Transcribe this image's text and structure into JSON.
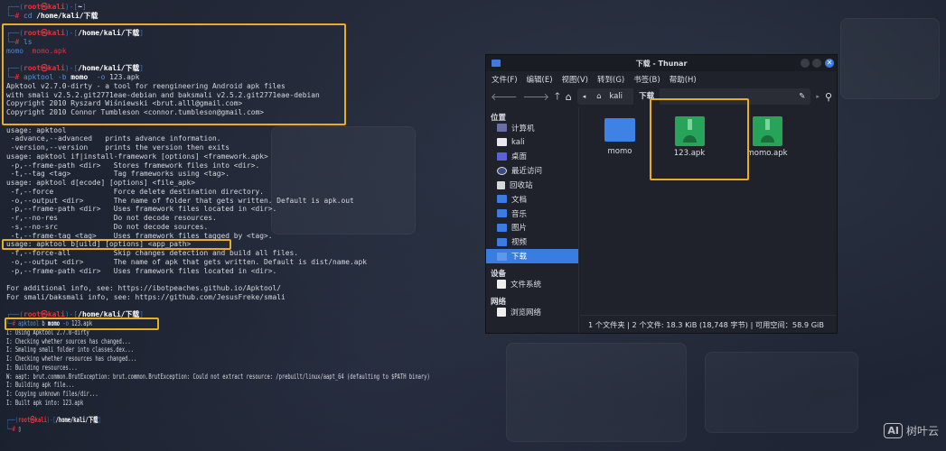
{
  "colors": {
    "frame": "#3c6fb5",
    "host": "#e3343e",
    "path": "#ffffff",
    "hash": "#e3343e",
    "text": "#d6d8de",
    "cmd": "#5b93d6",
    "dir": "#4a86e8",
    "apk": "#e3343e",
    "highlight": "#e8ad22",
    "accent": "#3a7de0"
  },
  "terminal": {
    "lines": [
      [
        [
          "┌──(",
          "frame"
        ],
        [
          "root㉿kali",
          "host"
        ],
        [
          ")-[",
          "frame"
        ],
        [
          "~",
          "path"
        ],
        [
          "]",
          "frame"
        ]
      ],
      [
        [
          "└─",
          "frame"
        ],
        [
          "# ",
          "hash"
        ],
        [
          "cd ",
          "cmd"
        ],
        [
          "/home/kali/下载",
          "path"
        ]
      ],
      [],
      [
        [
          "┌──(",
          "frame"
        ],
        [
          "root㉿kali",
          "host"
        ],
        [
          ")-[",
          "frame"
        ],
        [
          "/home/kali/下载",
          "path"
        ],
        [
          "]",
          "frame"
        ]
      ],
      [
        [
          "└─",
          "frame"
        ],
        [
          "# ",
          "hash"
        ],
        [
          "ls",
          "cmd"
        ]
      ],
      [
        [
          "momo",
          "dir"
        ],
        [
          "  ",
          "text"
        ],
        [
          "momo.apk",
          "apk"
        ]
      ],
      [],
      [
        [
          "┌──(",
          "frame"
        ],
        [
          "root㉿kali",
          "host"
        ],
        [
          ")-[",
          "frame"
        ],
        [
          "/home/kali/下载",
          "path"
        ],
        [
          "]",
          "frame"
        ]
      ],
      [
        [
          "└─",
          "frame"
        ],
        [
          "# ",
          "hash"
        ],
        [
          "apktool -b ",
          "cmd"
        ],
        [
          "momo",
          "path"
        ],
        [
          "  -o ",
          "cmd"
        ],
        [
          "123.apk",
          "text"
        ]
      ],
      [
        [
          "Apktool v2.7.0-dirty - a tool for reengineering Android apk files",
          "text"
        ]
      ],
      [
        [
          "with smali v2.5.2.git2771eae-debian and baksmali v2.5.2.git2771eae-debian",
          "text"
        ]
      ],
      [
        [
          "Copyright 2010 Ryszard Wiśniewski <brut.alll@gmail.com>",
          "text"
        ]
      ],
      [
        [
          "Copyright 2010 Connor Tumbleson <connor.tumbleson@gmail.com>",
          "text"
        ]
      ],
      [],
      [
        [
          "usage: apktool",
          "text"
        ]
      ],
      [
        [
          " -advance,--advanced   prints advance information.",
          "text"
        ]
      ],
      [
        [
          " -version,--version    prints the version then exits",
          "text"
        ]
      ],
      [
        [
          "usage: apktool if|install-framework [options] <framework.apk>",
          "text"
        ]
      ],
      [
        [
          " -p,--frame-path <dir>   Stores framework files into <dir>.",
          "text"
        ]
      ],
      [
        [
          " -t,--tag <tag>          Tag frameworks using <tag>.",
          "text"
        ]
      ],
      [
        [
          "usage: apktool d[ecode] [options] <file_apk>",
          "text"
        ]
      ],
      [
        [
          " -f,--force              Force delete destination directory.",
          "text"
        ]
      ],
      [
        [
          " -o,--output <dir>       The name of folder that gets written. Default is apk.out",
          "text"
        ]
      ],
      [
        [
          " -p,--frame-path <dir>   Uses framework files located in <dir>.",
          "text"
        ]
      ],
      [
        [
          " -r,--no-res             Do not decode resources.",
          "text"
        ]
      ],
      [
        [
          " -s,--no-src             Do not decode sources.",
          "text"
        ]
      ],
      [
        [
          " -t,--frame-tag <tag>    Uses framework files tagged by <tag>.",
          "text"
        ]
      ],
      [
        [
          "usage: apktool b[uild] [options] <app_path>",
          "text"
        ]
      ],
      [
        [
          " -f,--force-all          Skip changes detection and build all files.",
          "text"
        ]
      ],
      [
        [
          " -o,--output <dir>       The name of apk that gets written. Default is dist/name.apk",
          "text"
        ]
      ],
      [
        [
          " -p,--frame-path <dir>   Uses framework files located in <dir>.",
          "text"
        ]
      ],
      [],
      [
        [
          "For additional info, see: https://ibotpeaches.github.io/Apktool/",
          "text"
        ]
      ],
      [
        [
          "For smali/baksmali info, see: https://github.com/JesusFreke/smali",
          "text"
        ]
      ],
      [],
      [
        [
          "┌──(",
          "frame"
        ],
        [
          "root㉿kali",
          "host"
        ],
        [
          ")-[",
          "frame"
        ],
        [
          "/home/kali/下载",
          "path"
        ],
        [
          "]",
          "frame"
        ]
      ],
      [
        [
          "└─",
          "frame"
        ],
        [
          "# ",
          "hash"
        ],
        [
          "apktool ",
          "cmd"
        ],
        [
          "b ",
          "text"
        ],
        [
          "momo",
          "path"
        ],
        [
          " -o ",
          "cmd"
        ],
        [
          "123.apk",
          "text"
        ]
      ],
      [
        [
          "I: Using Apktool 2.7.0-dirty",
          "text"
        ]
      ],
      [
        [
          "I: Checking whether sources has changed...",
          "text"
        ]
      ],
      [
        [
          "I: Smaling smali folder into classes.dex...",
          "text"
        ]
      ],
      [
        [
          "I: Checking whether resources has changed...",
          "text"
        ]
      ],
      [
        [
          "I: Building resources...",
          "text"
        ]
      ],
      [
        [
          "W: aapt: brut.common.BrutException: brut.common.BrutException: Could not extract resource: /prebuilt/linux/aapt_64 (defaulting to $PATH binary)",
          "text"
        ]
      ],
      [
        [
          "I: Building apk file...",
          "text"
        ]
      ],
      [
        [
          "I: Copying unknown files/dir...",
          "text"
        ]
      ],
      [
        [
          "I: Built apk into: 123.apk",
          "text"
        ]
      ],
      [],
      [
        [
          "┌──(",
          "frame"
        ],
        [
          "root㉿kali",
          "host"
        ],
        [
          ")-[",
          "frame"
        ],
        [
          "/home/kali/下载",
          "path"
        ],
        [
          "]",
          "frame"
        ]
      ],
      [
        [
          "└─",
          "frame"
        ],
        [
          "# ",
          "hash"
        ],
        [
          "▯",
          "text"
        ]
      ]
    ]
  },
  "thunar": {
    "title": "下载 - Thunar",
    "menu": [
      "文件(F)",
      "编辑(E)",
      "视图(V)",
      "转到(G)",
      "书签(B)",
      "帮助(H)"
    ],
    "breadcrumb": [
      "kali",
      "下载"
    ],
    "sections": {
      "places": "位置",
      "devices": "设备",
      "network": "网络"
    },
    "places": [
      "计算机",
      "kali",
      "桌面",
      "最近访问",
      "回收站",
      "文档",
      "音乐",
      "图片",
      "视频",
      "下载"
    ],
    "devices": [
      "文件系统"
    ],
    "network": [
      "浏览网络"
    ],
    "files": [
      {
        "name": "momo",
        "type": "folder"
      },
      {
        "name": "123.apk",
        "type": "apk"
      },
      {
        "name": "momo.apk",
        "type": "apk"
      }
    ],
    "status": "1 个文件夹 | 2 个文件: 18.3 KiB (18,748 字节) | 可用空间：58.9 GiB"
  },
  "watermark": {
    "logo": "AI",
    "text": "树叶云"
  }
}
